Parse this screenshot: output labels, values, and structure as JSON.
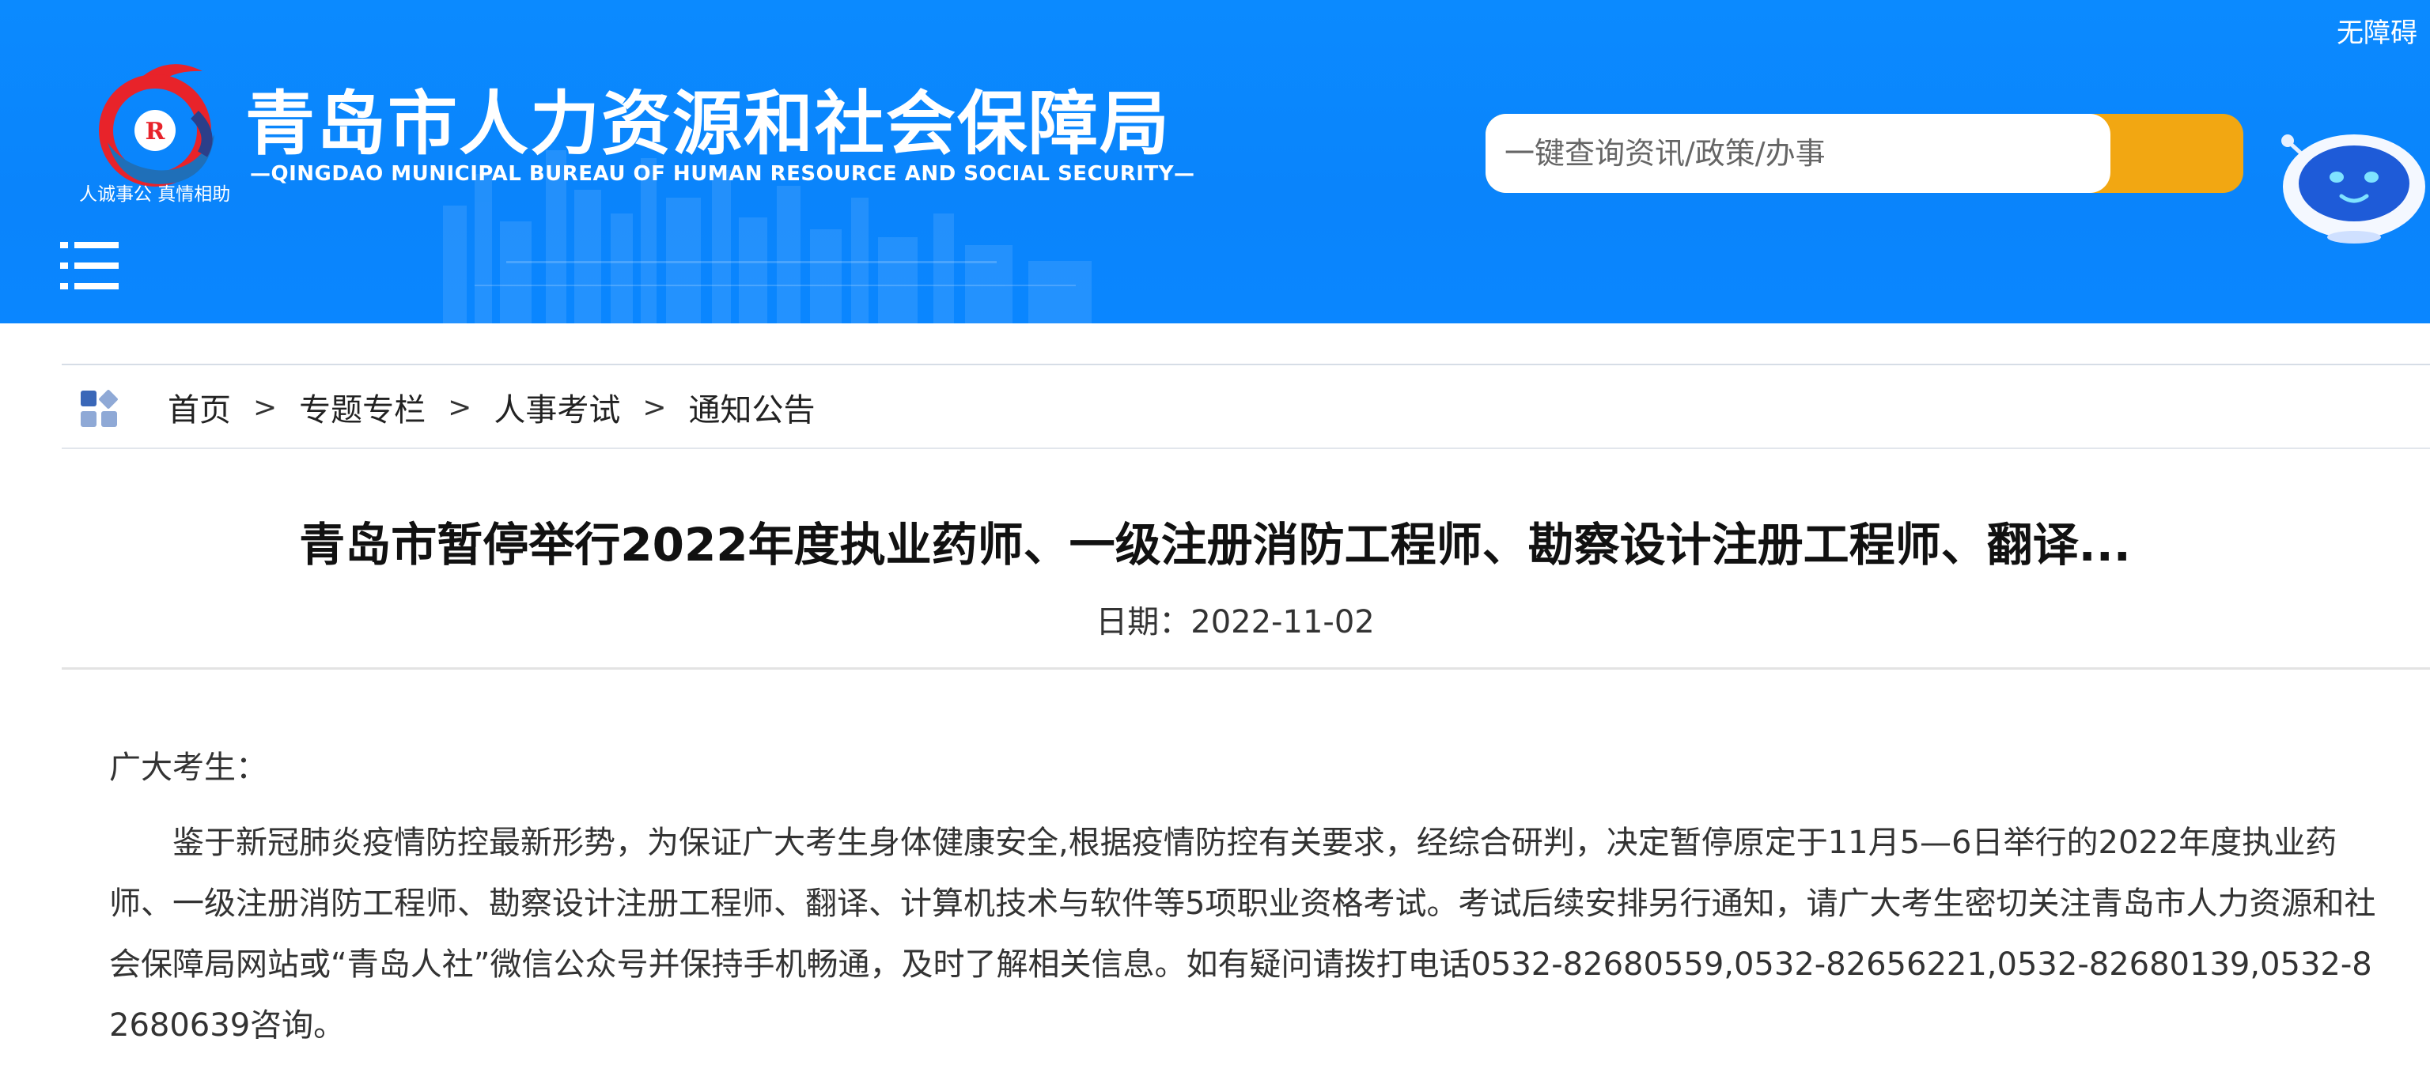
{
  "header": {
    "accessibility_label": "无障碍",
    "logo_motto": "人诚事公 真情相助",
    "site_title": "青岛市人力资源和社会保障局",
    "site_subtitle": "—QINGDAO MUNICIPAL BUREAU OF HUMAN RESOURCE AND SOCIAL SECURITY—",
    "search": {
      "placeholder": "一键查询资讯/政策/办事"
    },
    "colors": {
      "banner": "#0a86ff",
      "search_button": "#f2a712"
    }
  },
  "icons": {
    "menu": "hamburger-list-icon",
    "breadcrumb": "grid-apps-icon",
    "robot": "assistant-robot-icon",
    "logo": "bureau-emblem-icon"
  },
  "breadcrumb": {
    "items": [
      {
        "label": "首页"
      },
      {
        "label": "专题专栏"
      },
      {
        "label": "人事考试"
      },
      {
        "label": "通知公告"
      }
    ],
    "separator": ">"
  },
  "article": {
    "title": "青岛市暂停举行2022年度执业药师、一级注册消防工程师、勘察设计注册工程师、翻译...",
    "date": "日期：2022-11-02",
    "greeting": "广大考生：",
    "body": "鉴于新冠肺炎疫情防控最新形势，为保证广大考生身体健康安全,根据疫情防控有关要求，经综合研判，决定暂停原定于11月5—6日举行的2022年度执业药师、一级注册消防工程师、勘察设计注册工程师、翻译、计算机技术与软件等5项职业资格考试。考试后续安排另行通知，请广大考生密切关注青岛市人力资源和社会保障局网站或“青岛人社”微信公众号并保持手机畅通，及时了解相关信息。如有疑问请拨打电话0532-82680559,0532-82656221,0532-82680139,0532-82680639咨询。"
  }
}
